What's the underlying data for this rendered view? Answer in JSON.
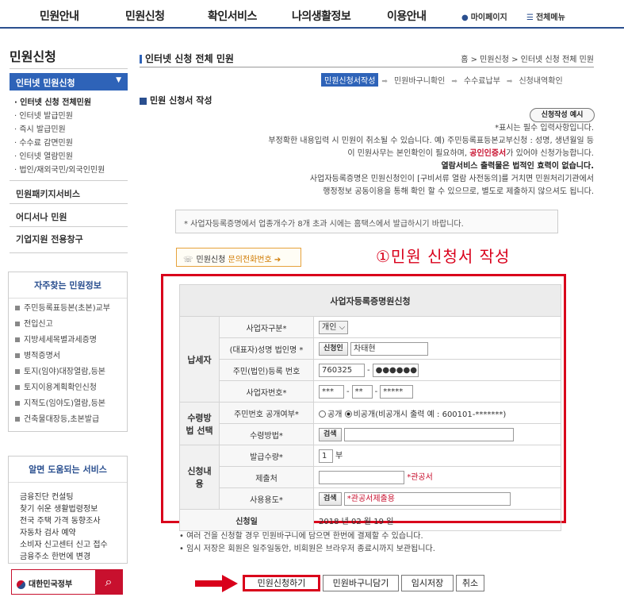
{
  "topnav": {
    "items": [
      "민원안내",
      "민원신청",
      "확인서비스",
      "나의생활정보",
      "이용안내"
    ],
    "mypage": "마이페이지",
    "allmenu": "전체메뉴"
  },
  "sidebar": {
    "title": "민원신청",
    "active": "인터넷 민원신청",
    "subitems": [
      "· 인터넷 신청 전체민원",
      "· 인터넷 발급민원",
      "· 즉시 발급민원",
      "· 수수료 감면민원",
      "· 인터넷 열람민원",
      "· 법인/재외국민/외국인민원"
    ],
    "main_items": [
      "민원패키지서비스",
      "어디서나 민원",
      "기업지원 전용창구"
    ],
    "freq_title": "자주찾는 민원정보",
    "freq_items": [
      "주민등록표등본(초본)교부",
      "전입신고",
      "지방세세목별과세증명",
      "병적증명서",
      "토지(임야)대장열람,등본",
      "토지이용계획확인신청",
      "지적도(임야도)열람,등본",
      "건축물대장등,초본발급"
    ],
    "help_title": "알면 도움되는 서비스",
    "help_items": [
      "금융진단 컨설팅",
      "찾기 쉬운 생활법령정보",
      "전국 주택 가격 동향조사",
      "자동차 검사 예약",
      "소비자 신고센터 신고 접수",
      "금융주소 한번에 변경"
    ],
    "gov_label": "대한민국정부"
  },
  "main": {
    "title": "인터넷 신청 전체 민원",
    "breadcrumb": "홈 > 민원신청 > 인터넷 신청 전체 민원",
    "steps": [
      "민원신청서작성",
      "민원바구니확인",
      "수수료납부",
      "신청내역확인"
    ],
    "section_title": "민원 신청서 작성",
    "example_btn": "신청작성 예시",
    "notes": {
      "line1": "*표시는 필수 입력사항입니다.",
      "line2": "부정확한 내용입력 시 민원이 취소될 수 있습니다. 예) 주민등록표등본교부신청 : 성명, 생년월일 등",
      "line3a": "이 민원사무는 본인확인이 필요하며, ",
      "line3red": "공인인증서",
      "line3b": "가 있어야 신청가능합니다.",
      "line4": "열람서비스 출력물은 법적인 효력이 없습니다.",
      "line5": "사업자등록증명은 민원신청인이 [구비서류 열람 사전동의]를 거치면 민원처리기관에서",
      "line6": "행정정보 공동이용을 통해 확인 할 수 있으므로, 별도로 제출하지 않으셔도 됩니다."
    },
    "infobox": "* 사업자등록증명에서 업종개수가 8개 초과 시에는 홈택스에서 발급하시기 바랍니다.",
    "contact": {
      "prefix": "민원신청 ",
      "highlight": "문의전화번호",
      "arrow": "➔"
    },
    "annotation": "①민원 신청서 작성",
    "form": {
      "title": "사업자등록증명원신청",
      "group_taxpayer": "납세자",
      "group_receive": "수령방법 선택",
      "group_apply": "신청내용",
      "biz_type_label": "사업자구분*",
      "biz_type_value": "개인",
      "name_label": "(대표자)성명 법인명 *",
      "name_btn": "신청인",
      "name_value": "차태현",
      "rrn_label": "주민(법인)등록 번호",
      "rrn_front": "760325",
      "rrn_back": "●●●●●●",
      "biz_no_label": "사업자번호*",
      "biz_no_1": "***",
      "biz_no_2": "**",
      "biz_no_3": "*****",
      "disclose_label": "주민번호 공개여부*",
      "disclose_opt1": "공개",
      "disclose_opt2": "비공개(비공개시 출력 예 : 600101-*******)",
      "receive_label": "수령방법*",
      "search_btn": "검색",
      "count_label": "발급수량*",
      "count_value": "1",
      "count_unit": "부",
      "submit_to_label": "제출처",
      "submit_to_hint": "*관공서",
      "purpose_label": "사용용도*",
      "purpose_value": "*관공서제출용",
      "date_label": "신청일",
      "date_value": "2018 년 02 월 19 일"
    },
    "bottom_notes": [
      "• 여러 건을 신청할 경우 민원바구니에 담으면 한번에 결제할 수 있습니다.",
      "• 임시 저장은 회원은 일주일동안, 비회원은 브라우저 종료시까지 보관됩니다."
    ],
    "actions": [
      "민원신청하기",
      "민원바구니담기",
      "임시저장",
      "취소"
    ]
  },
  "colors": {
    "brand": "#2a4f8f",
    "accent": "#2e63b8",
    "highlight": "#d9001b"
  }
}
